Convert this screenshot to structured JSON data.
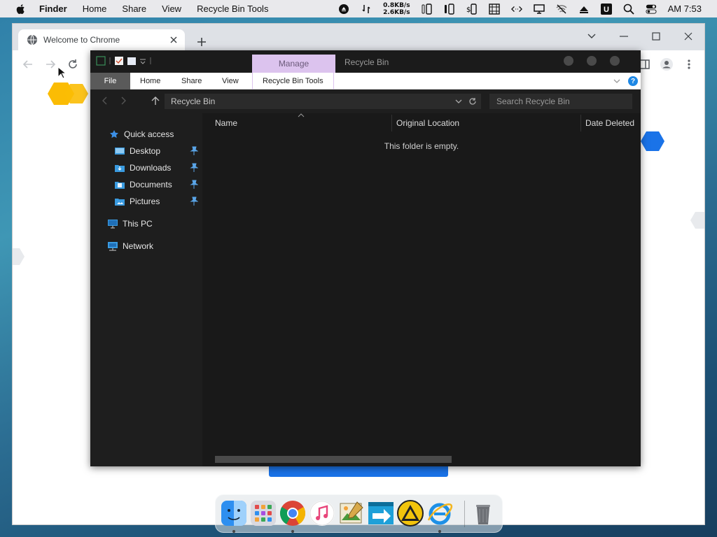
{
  "menubar": {
    "app_name": "Finder",
    "items": [
      "Home",
      "Share",
      "View",
      "Recycle Bin Tools"
    ],
    "net_up": "0.8KB/s",
    "net_down": "2.6KB/s",
    "clock": "AM 7:53",
    "status_icons": [
      "eject-icon",
      "transfer-icon",
      "battery-phone-icon",
      "phone-icon",
      "dollar-phone-icon",
      "grid-icon",
      "code-arrows-icon",
      "display-icon",
      "wifi-off-icon",
      "upload-triangle-icon",
      "u-icon",
      "search-icon",
      "toggle-icon"
    ]
  },
  "chrome": {
    "tab_title": "Welcome to Chrome",
    "colors": {
      "tabstrip": "#dee1e6",
      "accent_blue": "#1a73e8",
      "yellow": "#fbbc04"
    }
  },
  "explorer": {
    "manage_label": "Manage",
    "title": "Recycle Bin",
    "ribbon_tabs": {
      "file": "File",
      "home": "Home",
      "share": "Share",
      "view": "View",
      "tools": "Recycle Bin Tools"
    },
    "help": "?",
    "address": "Recycle Bin",
    "search_placeholder": "Search Recycle Bin",
    "sidebar": {
      "quick_access": "Quick access",
      "pinned": [
        "Desktop",
        "Downloads",
        "Documents",
        "Pictures"
      ],
      "this_pc": "This PC",
      "network": "Network"
    },
    "columns": [
      "Name",
      "Original Location",
      "Date Deleted"
    ],
    "empty_message": "This folder is empty.",
    "colors": {
      "manage_tab": "#dcc3ee",
      "background": "#1e1e1e",
      "file_tab": "#5a5a5a"
    }
  },
  "dock": {
    "apps": [
      "finder-icon",
      "launchpad-icon",
      "chrome-icon",
      "music-icon",
      "image-editor-icon",
      "migration-arrow-icon",
      "triangle-warning-app-icon",
      "internet-explorer-icon",
      "trash-icon"
    ]
  }
}
